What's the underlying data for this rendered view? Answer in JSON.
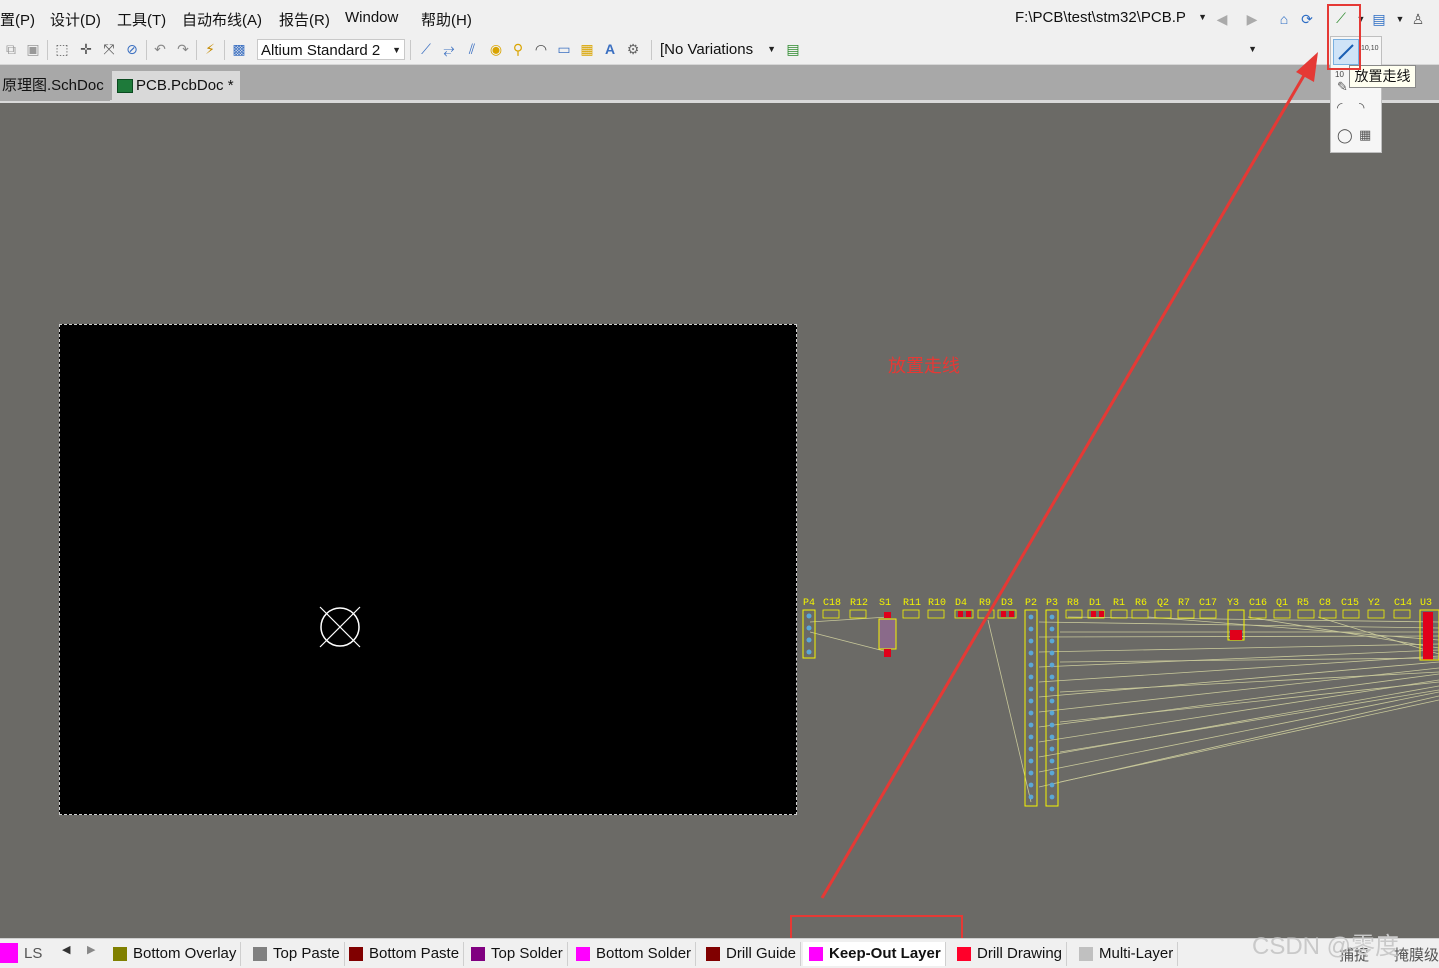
{
  "menu": {
    "items": [
      "置(P)",
      "设计(D)",
      "工具(T)",
      "自动布线(A)",
      "报告(R)",
      "Window",
      "帮助(H)"
    ],
    "path": "F:\\PCB\\test\\stm32\\PCB.P"
  },
  "toolbar": {
    "rule_set": "Altium Standard 2",
    "variations": "[No Variations"
  },
  "tabs": [
    {
      "label": "原理图.SchDoc"
    },
    {
      "label": "PCB.PcbDoc *"
    }
  ],
  "popup": {
    "tooltip": "放置走线",
    "label_10_10": "10,10",
    "label_10": "10"
  },
  "annotation": {
    "text": "放置走线"
  },
  "layers": {
    "ls_label": "LS",
    "tabs": [
      {
        "label": "Bottom Overlay",
        "color": "#808000"
      },
      {
        "label": "Top Paste",
        "color": "#808080"
      },
      {
        "label": "Bottom Paste",
        "color": "#800000"
      },
      {
        "label": "Top Solder",
        "color": "#800080"
      },
      {
        "label": "Bottom Solder",
        "color": "#ff00ff"
      },
      {
        "label": "Drill Guide",
        "color": "#800000"
      },
      {
        "label": "Keep-Out Layer",
        "color": "#ff00ff"
      },
      {
        "label": "Drill Drawing",
        "color": "#ff002a"
      },
      {
        "label": "Multi-Layer",
        "color": "#c0c0c0"
      }
    ],
    "right": [
      "捕捉",
      "掩膜级"
    ]
  },
  "designators": [
    "P4",
    "C18",
    "R12",
    "S1",
    "R11",
    "R10",
    "D4",
    "R9",
    "D3",
    "P2",
    "P3",
    "R8",
    "D1",
    "R1",
    "R6",
    "Q2",
    "R7",
    "C17",
    "Y3",
    "C16",
    "Q1",
    "R5",
    "C8",
    "C15",
    "Y2",
    "C14",
    "U3"
  ],
  "watermark": "CSDN @零度",
  "colors": {
    "annotation_red": "#e53935",
    "silkscreen_yellow": "#f4f400",
    "ratsnest": "#c8c89a",
    "keepout_magenta": "#ff00ff"
  }
}
